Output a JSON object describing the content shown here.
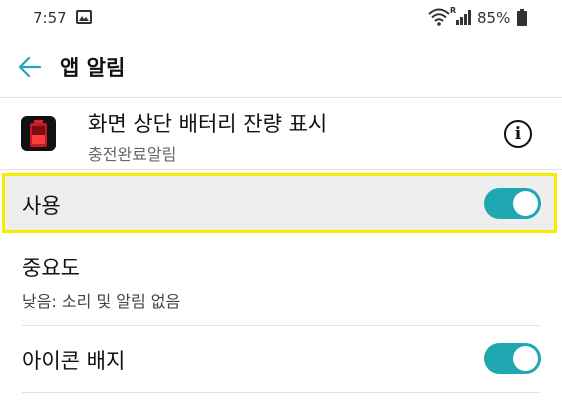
{
  "status_bar": {
    "time": "7:57",
    "battery_percent": "85%",
    "roaming_indicator": "R",
    "icons": [
      "gallery-icon",
      "wifi-icon",
      "signal-icon",
      "battery-icon"
    ]
  },
  "toolbar": {
    "title": "앱 알림",
    "back_icon": "arrow-left"
  },
  "app": {
    "name": "화면 상단 배터리 잔량 표시",
    "subtitle": "충전완료알림",
    "info_icon": "info-circle"
  },
  "settings": {
    "use": {
      "label": "사용",
      "enabled": true
    },
    "importance": {
      "label": "중요도",
      "value": "낮음: 소리 및 알림 없음"
    },
    "icon_badge": {
      "label": "아이콘 배지",
      "enabled": true
    }
  },
  "colors": {
    "accent": "#20a8b2",
    "highlight_border": "#f5ec00",
    "highlight_bg": "#eeeeee"
  }
}
